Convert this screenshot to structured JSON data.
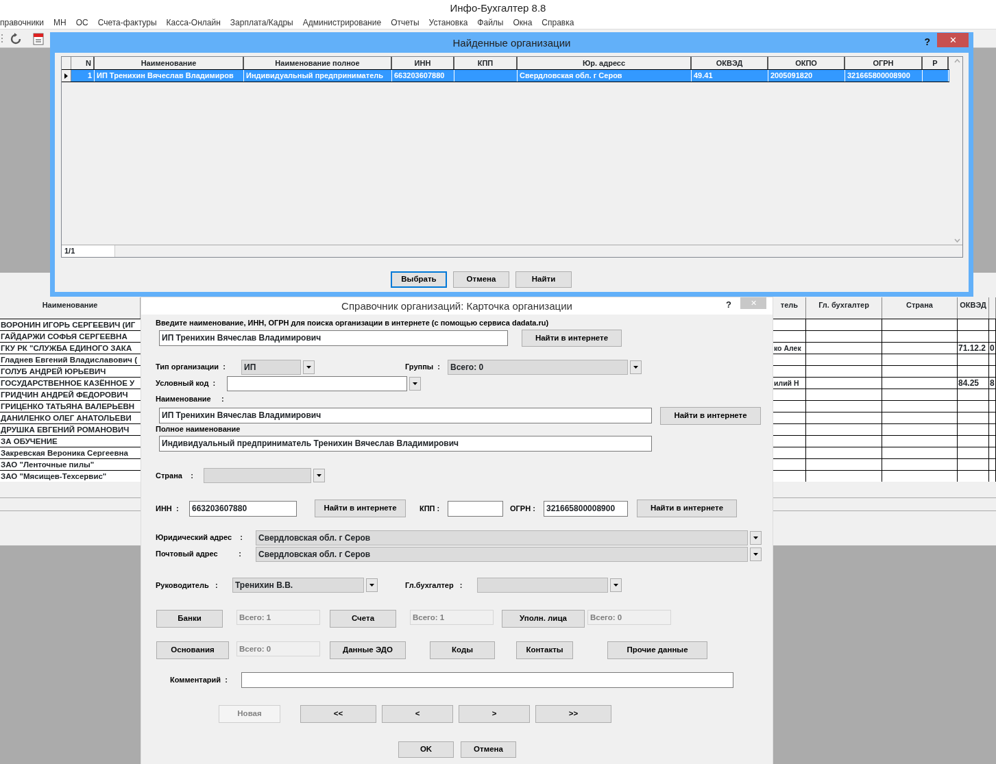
{
  "app": {
    "title": "Инфо-Бухгалтер 8.8",
    "menu": [
      "правочники",
      "МН",
      "ОС",
      "Счета-фактуры",
      "Касса-Онлайн",
      "Зарплата/Кадры",
      "Администрирование",
      "Отчеты",
      "Установка",
      "Файлы",
      "Окна",
      "Справка"
    ]
  },
  "background_list": {
    "left_column": "Наименование",
    "names": [
      "ВОРОНИН ИГОРЬ СЕРГЕЕВИЧ (ИГ",
      "ГАЙДАРЖИ СОФЬЯ СЕРГЕЕВНА",
      "ГКУ РК \"СЛУЖБА ЕДИНОГО ЗАКА",
      "Гладнев Евгений Владиславович (",
      "ГОЛУБ АНДРЕЙ ЮРЬЕВИЧ",
      "ГОСУДАРСТВЕННОЕ КАЗЁННОЕ У",
      "ГРИДЧИН АНДРЕЙ ФЕДОРОВИЧ",
      "ГРИЦЕНКО ТАТЬЯНА ВАЛЕРЬЕВН",
      "ДАНИЛЕНКО ОЛЕГ АНАТОЛЬЕВИ",
      "ДРУШКА ЕВГЕНИЙ РОМАНОВИЧ",
      "ЗА ОБУЧЕНИЕ",
      "Закревская Вероника Сергеевна",
      "ЗАО \"Ленточные пилы\"",
      "ЗАО \"Мясищев-Техсервис\""
    ],
    "right_columns": [
      "тель",
      "Гл. бухгалтер",
      "Страна",
      "ОКВЭД"
    ],
    "right_rows": [
      {},
      {},
      {
        "column_1": "ко Алек",
        "okved": "71.12.2",
        "column_5": "0"
      },
      {},
      {},
      {
        "column_1": "илий Н",
        "okved": "84.25",
        "column_5": "8"
      }
    ]
  },
  "found_dialog": {
    "title": "Найденные организации",
    "help": "?",
    "close": "✕",
    "columns": [
      "N",
      "Наименование",
      "Наименование полное",
      "ИНН",
      "КПП",
      "Юр. адресс",
      "ОКВЭД",
      "ОКПО",
      "ОГРН",
      "Р"
    ],
    "rows": [
      {
        "selected": true,
        "cells": [
          "1",
          "ИП Тренихин Вячеслав Владимиров",
          "Индивидуальный предприниматель",
          "663203607880",
          "",
          "Свердловская обл. г Серов",
          "49.41",
          "2005091820",
          "321665800008900",
          ""
        ]
      }
    ],
    "counter": "1/1",
    "buttons": [
      {
        "label": "Выбрать",
        "default": true
      },
      {
        "label": "Отмена",
        "default": false
      },
      {
        "label": "Найти",
        "default": false
      }
    ]
  },
  "card": {
    "title": "Справочник организаций: Карточка организации",
    "help": "?",
    "close": "✕",
    "search_hint": "Введите наименование, ИНН, ОГРН для поиска организации в интернете (с помощью сервиса dadata.ru)",
    "search_value": "ИП Тренихин Вячеслав Владимирович",
    "search_button": "Найти в интернете",
    "org_type": {
      "label": "Тип организации  :",
      "value": "ИП",
      "editable": false
    },
    "groups": {
      "label": "Группы  :",
      "value": "Всего: 0",
      "editable": false
    },
    "code": {
      "label": "Условный код  :",
      "editable": true
    },
    "name": {
      "label": "Наименование     :",
      "value": "ИП Тренихин Вячеслав Владимирович",
      "button": "Найти в интернете"
    },
    "full_name": {
      "label": "Полное наименование",
      "value": "Индивидуальный предприниматель Тренихин Вячеслав Владимирович"
    },
    "country": {
      "label": "Страна    :",
      "editable": false
    },
    "inn": {
      "label": "ИНН  :",
      "value": "663203607880",
      "button": "Найти в интернете"
    },
    "kpp": {
      "label": "КПП :"
    },
    "ogrn": {
      "label": "ОГРН :",
      "value": "321665800008900",
      "button": "Найти в интернете"
    },
    "legal_address": {
      "label": "Юридический адрес    :",
      "value": "Свердловская обл. г Серов",
      "editable": false
    },
    "postal_address": {
      "label": "Почтовый адрес          :",
      "value": "Свердловская обл. г Серов",
      "editable": false
    },
    "director": {
      "label": "Руководитель   :",
      "value": "Тренихин В.В.",
      "editable": false
    },
    "accountant": {
      "label": "Гл.бухгалтер   :",
      "editable": false
    },
    "links": [
      {
        "button": "Банки",
        "count": "Всего: 1"
      },
      {
        "button": "Счета",
        "count": "Всего: 1"
      },
      {
        "button": "Уполн. лица",
        "count": "Всего: 0"
      }
    ],
    "more": [
      {
        "button": "Основания",
        "count": "Всего: 0"
      },
      {
        "button": "Данные ЭДО"
      },
      {
        "button": "Коды"
      },
      {
        "button": "Контакты"
      },
      {
        "button": "Прочие данные"
      }
    ],
    "comment": {
      "label": "Комментарий  :"
    },
    "nav": [
      {
        "label": "Новая",
        "disabled": true
      },
      {
        "label": "<<",
        "disabled": false
      },
      {
        "label": "<",
        "disabled": false
      },
      {
        "label": ">",
        "disabled": false
      },
      {
        "label": ">>",
        "disabled": false
      }
    ],
    "footer": [
      "OK",
      "Отмена"
    ]
  }
}
